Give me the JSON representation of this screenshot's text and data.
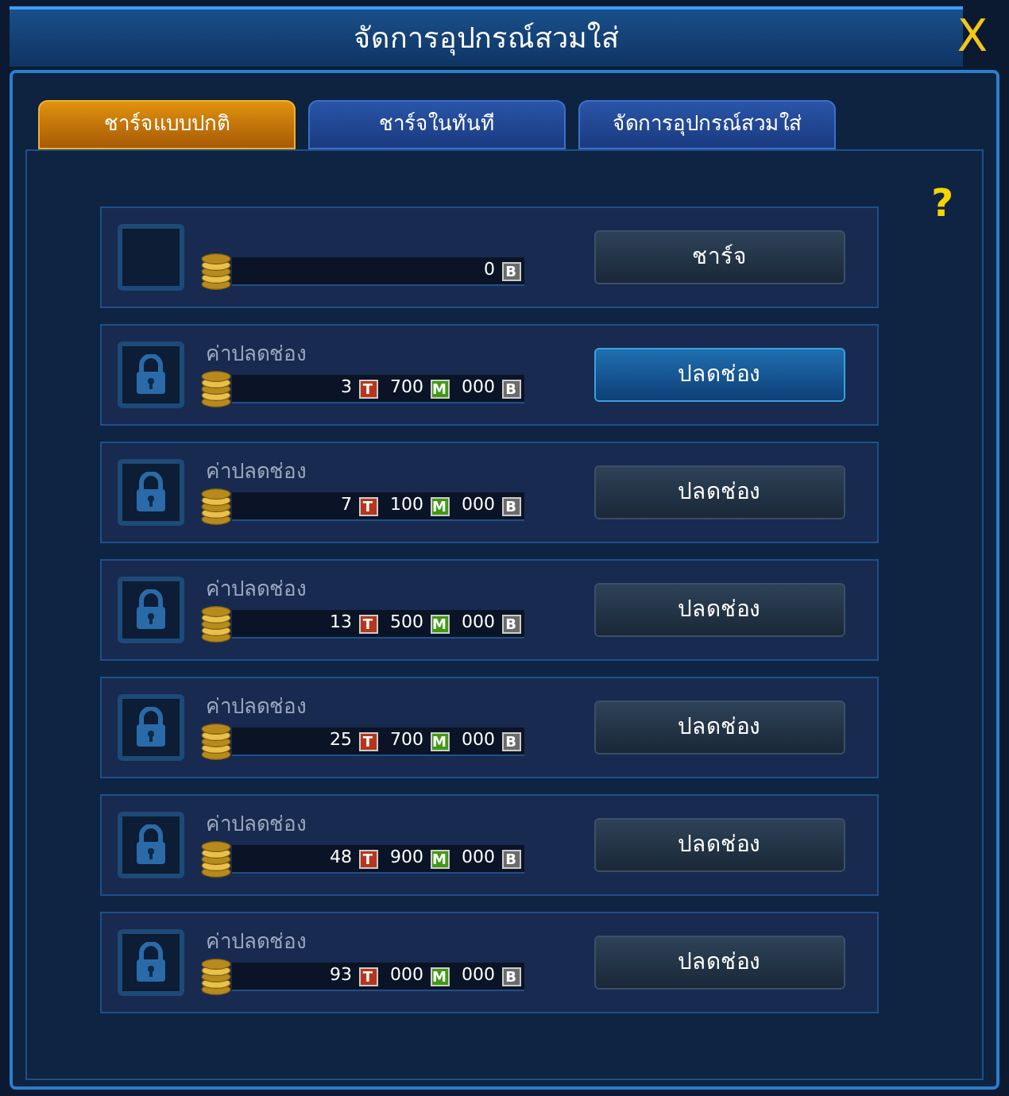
{
  "window": {
    "title": "จัดการอุปกรณ์สวมใส่",
    "close": "X"
  },
  "tabs": [
    {
      "label": "ชาร์จแบบปกติ",
      "selected": true
    },
    {
      "label": "ชาร์จในทันที",
      "selected": false
    },
    {
      "label": "จัดการอุปกรณ์สวมใส่",
      "selected": false
    }
  ],
  "help": "?",
  "slots": [
    {
      "kind": "empty",
      "cost": [
        {
          "value": "0",
          "unit": "B",
          "color": "#6b6b6b"
        }
      ],
      "button": {
        "label": "ชาร์จ",
        "highlighted": false
      }
    },
    {
      "kind": "locked",
      "caption": "ค่าปลดช่อง",
      "cost": [
        {
          "value": "3",
          "unit": "T",
          "color": "#b5361c"
        },
        {
          "value": "700",
          "unit": "M",
          "color": "#3f9a12"
        },
        {
          "value": "000",
          "unit": "B",
          "color": "#6b6b6b"
        }
      ],
      "button": {
        "label": "ปลดช่อง",
        "highlighted": true
      }
    },
    {
      "kind": "locked",
      "caption": "ค่าปลดช่อง",
      "cost": [
        {
          "value": "7",
          "unit": "T",
          "color": "#b5361c"
        },
        {
          "value": "100",
          "unit": "M",
          "color": "#3f9a12"
        },
        {
          "value": "000",
          "unit": "B",
          "color": "#6b6b6b"
        }
      ],
      "button": {
        "label": "ปลดช่อง",
        "highlighted": false
      }
    },
    {
      "kind": "locked",
      "caption": "ค่าปลดช่อง",
      "cost": [
        {
          "value": "13",
          "unit": "T",
          "color": "#b5361c"
        },
        {
          "value": "500",
          "unit": "M",
          "color": "#3f9a12"
        },
        {
          "value": "000",
          "unit": "B",
          "color": "#6b6b6b"
        }
      ],
      "button": {
        "label": "ปลดช่อง",
        "highlighted": false
      }
    },
    {
      "kind": "locked",
      "caption": "ค่าปลดช่อง",
      "cost": [
        {
          "value": "25",
          "unit": "T",
          "color": "#b5361c"
        },
        {
          "value": "700",
          "unit": "M",
          "color": "#3f9a12"
        },
        {
          "value": "000",
          "unit": "B",
          "color": "#6b6b6b"
        }
      ],
      "button": {
        "label": "ปลดช่อง",
        "highlighted": false
      }
    },
    {
      "kind": "locked",
      "caption": "ค่าปลดช่อง",
      "cost": [
        {
          "value": "48",
          "unit": "T",
          "color": "#b5361c"
        },
        {
          "value": "900",
          "unit": "M",
          "color": "#3f9a12"
        },
        {
          "value": "000",
          "unit": "B",
          "color": "#6b6b6b"
        }
      ],
      "button": {
        "label": "ปลดช่อง",
        "highlighted": false
      }
    },
    {
      "kind": "locked",
      "caption": "ค่าปลดช่อง",
      "cost": [
        {
          "value": "93",
          "unit": "T",
          "color": "#b5361c"
        },
        {
          "value": "000",
          "unit": "M",
          "color": "#3f9a12"
        },
        {
          "value": "000",
          "unit": "B",
          "color": "#6b6b6b"
        }
      ],
      "button": {
        "label": "ปลดช่อง",
        "highlighted": false
      }
    }
  ]
}
